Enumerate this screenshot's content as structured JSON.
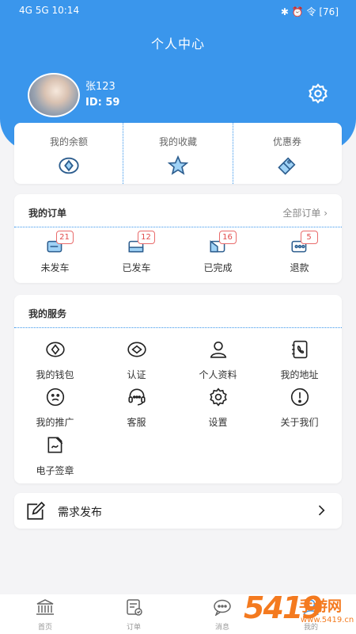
{
  "status_bar": {
    "left": "4G  5G  10:14",
    "right": "✱ ⏰ 令 [76]"
  },
  "header": {
    "title": "个人中心"
  },
  "profile": {
    "name": "张123",
    "id": "ID:  59"
  },
  "balance_row": [
    {
      "label": "我的余额",
      "icon": "wallet-icon"
    },
    {
      "label": "我的收藏",
      "icon": "star-icon"
    },
    {
      "label": "优惠券",
      "icon": "coupon-icon"
    }
  ],
  "orders": {
    "title": "我的订单",
    "all_label": "全部订单 ›",
    "items": [
      {
        "label": "未发车",
        "count": "21"
      },
      {
        "label": "已发车",
        "count": "12"
      },
      {
        "label": "已完成",
        "count": "16"
      },
      {
        "label": "退款",
        "count": "5"
      }
    ]
  },
  "services": {
    "title": "我的服务",
    "items": [
      {
        "label": "我的钱包",
        "icon": "wallet-icon"
      },
      {
        "label": "认证",
        "icon": "certify-icon"
      },
      {
        "label": "个人资料",
        "icon": "person-icon"
      },
      {
        "label": "我的地址",
        "icon": "address-book-icon"
      },
      {
        "label": "我的推广",
        "icon": "promotion-icon"
      },
      {
        "label": "客服",
        "icon": "headset-icon"
      },
      {
        "label": "设置",
        "icon": "gear-icon"
      },
      {
        "label": "关于我们",
        "icon": "info-icon"
      },
      {
        "label": "电子签章",
        "icon": "signature-icon"
      }
    ]
  },
  "publish": {
    "label": "需求发布"
  },
  "tabbar": [
    {
      "label": "首页",
      "icon": "home-icon"
    },
    {
      "label": "订单",
      "icon": "order-icon"
    },
    {
      "label": "消息",
      "icon": "message-icon"
    },
    {
      "label": "我的",
      "icon": "user-icon"
    }
  ],
  "watermark": {
    "number": "5419",
    "text": "手游网",
    "url": "www.5419.cn"
  },
  "colors": {
    "accent": "#3a96ec",
    "badge": "#e14b4b",
    "watermark": "#f47a1f"
  }
}
